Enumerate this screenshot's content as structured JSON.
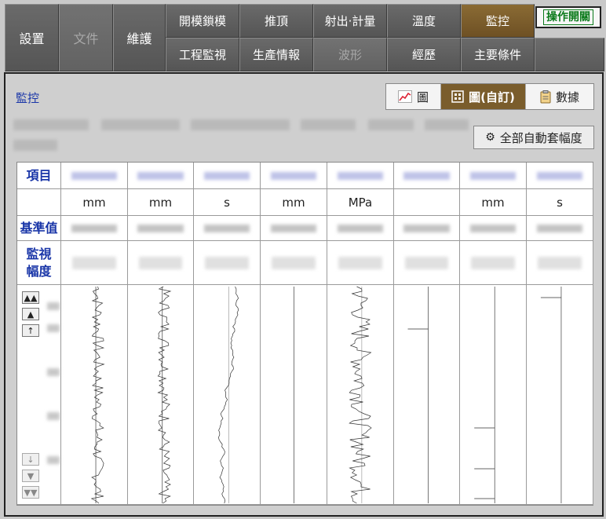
{
  "nav": {
    "settings": "設置",
    "file": "文件",
    "maintenance": "維護",
    "mold_open_close": "開模鎖模",
    "ejector": "推頂",
    "injection_metering": "射出‧計量",
    "temperature": "溫度",
    "monitor": "監控",
    "process_monitor": "工程監視",
    "production_info": "生產情報",
    "waveform": "波形",
    "history": "經歷",
    "main_conditions": "主要條件",
    "operation_toggle": "操作開關"
  },
  "panel": {
    "title": "監控",
    "views": [
      "圖",
      "圖(自訂)",
      "數據"
    ],
    "active_view": "圖(自訂)",
    "auto_range_button": "全部自動套幅度"
  },
  "grid": {
    "row_labels": {
      "item": "項目",
      "reference": "基準值",
      "range": "監視幅度"
    },
    "units": [
      "mm",
      "mm",
      "s",
      "mm",
      "MPa",
      "",
      "mm",
      "s"
    ]
  },
  "colors": {
    "accent": "#7a5d2c",
    "label_blue": "#1a36a8",
    "toggle_green": "#0a7a1a"
  }
}
